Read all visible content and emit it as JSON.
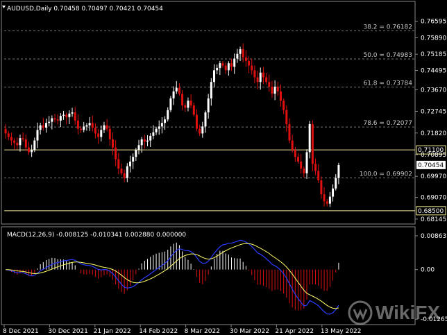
{
  "header": {
    "symbol": "AUDUSD,Daily",
    "ohlc": "0.70458 0.70497 0.70421 0.70454"
  },
  "fib_levels": [
    {
      "label": "38.2 = 0.76182",
      "price": 0.76182
    },
    {
      "label": "50.0 = 0.74983",
      "price": 0.74983
    },
    {
      "label": "61.8 = 0.73784",
      "price": 0.73784
    },
    {
      "label": "78.6 = 0.72077",
      "price": 0.72077
    },
    {
      "label": "100.0 = 0.69902",
      "price": 0.69902
    }
  ],
  "price_axis": {
    "ticks": [
      "0.76595",
      "0.75890",
      "0.75185",
      "0.74495",
      "0.73670",
      "0.72745",
      "0.71820",
      "0.70895",
      "0.69970",
      "0.69070",
      "0.68145"
    ],
    "tick_prices": [
      0.76595,
      0.7589,
      0.75185,
      0.74495,
      0.7367,
      0.72745,
      0.7182,
      0.70895,
      0.6997,
      0.6907,
      0.68145
    ],
    "range": [
      0.6808,
      0.7685
    ]
  },
  "hlines": [
    {
      "label": "0.71100",
      "price": 0.711,
      "color": "#f0e68c"
    },
    {
      "label": "0.68500",
      "price": 0.685,
      "color": "#f0e68c"
    }
  ],
  "current_price": {
    "label": "0.70454",
    "price": 0.70454
  },
  "macd": {
    "title": "MACD(12,26,9) -0.008125 -0.010341 0.002880 0.000000",
    "axis_ticks": [
      "0.00863",
      "0.00",
      "-0.012657"
    ],
    "tick_values": [
      0.00863,
      0.0,
      -0.012657
    ],
    "range": [
      -0.0135,
      0.0095
    ]
  },
  "time_axis": [
    "8 Dec 2021",
    "30 Dec 2021",
    "21 Jan 2022",
    "14 Feb 2022",
    "8 Mar 2022",
    "30 Mar 2022",
    "21 Apr 2022",
    "13 May 2022"
  ],
  "watermark": "WikiFX",
  "colors": {
    "up": "#ffffff",
    "down": "#e01010",
    "signal": "#ffff66",
    "macd_line": "#2b3cff",
    "level": "#f0e68c",
    "grid": "#7a7a7a"
  },
  "chart_data": {
    "type": "candlestick",
    "closes": [
      0.718,
      0.7165,
      0.715,
      0.714,
      0.713,
      0.716,
      0.7155,
      0.712,
      0.71,
      0.711,
      0.715,
      0.7195,
      0.7215,
      0.7205,
      0.7225,
      0.723,
      0.7245,
      0.724,
      0.7235,
      0.7255,
      0.726,
      0.725,
      0.7265,
      0.727,
      0.7235,
      0.72,
      0.7195,
      0.721,
      0.7215,
      0.7225,
      0.7205,
      0.718,
      0.7165,
      0.7195,
      0.7215,
      0.72,
      0.7155,
      0.712,
      0.707,
      0.703,
      0.701,
      0.699,
      0.704,
      0.706,
      0.708,
      0.711,
      0.713,
      0.7155,
      0.7145,
      0.715,
      0.717,
      0.7185,
      0.72,
      0.721,
      0.7225,
      0.724,
      0.728,
      0.733,
      0.736,
      0.7375,
      0.735,
      0.73,
      0.729,
      0.732,
      0.73,
      0.726,
      0.72,
      0.718,
      0.721,
      0.727,
      0.733,
      0.74,
      0.745,
      0.746,
      0.748,
      0.747,
      0.745,
      0.748,
      0.7465,
      0.75,
      0.752,
      0.754,
      0.7505,
      0.749,
      0.747,
      0.745,
      0.742,
      0.74,
      0.744,
      0.742,
      0.74,
      0.738,
      0.735,
      0.738,
      0.736,
      0.732,
      0.728,
      0.722,
      0.715,
      0.711,
      0.708,
      0.706,
      0.703,
      0.701,
      0.71,
      0.722,
      0.705,
      0.702,
      0.698,
      0.692,
      0.689,
      0.688,
      0.691,
      0.6945,
      0.699,
      0.7045
    ]
  }
}
